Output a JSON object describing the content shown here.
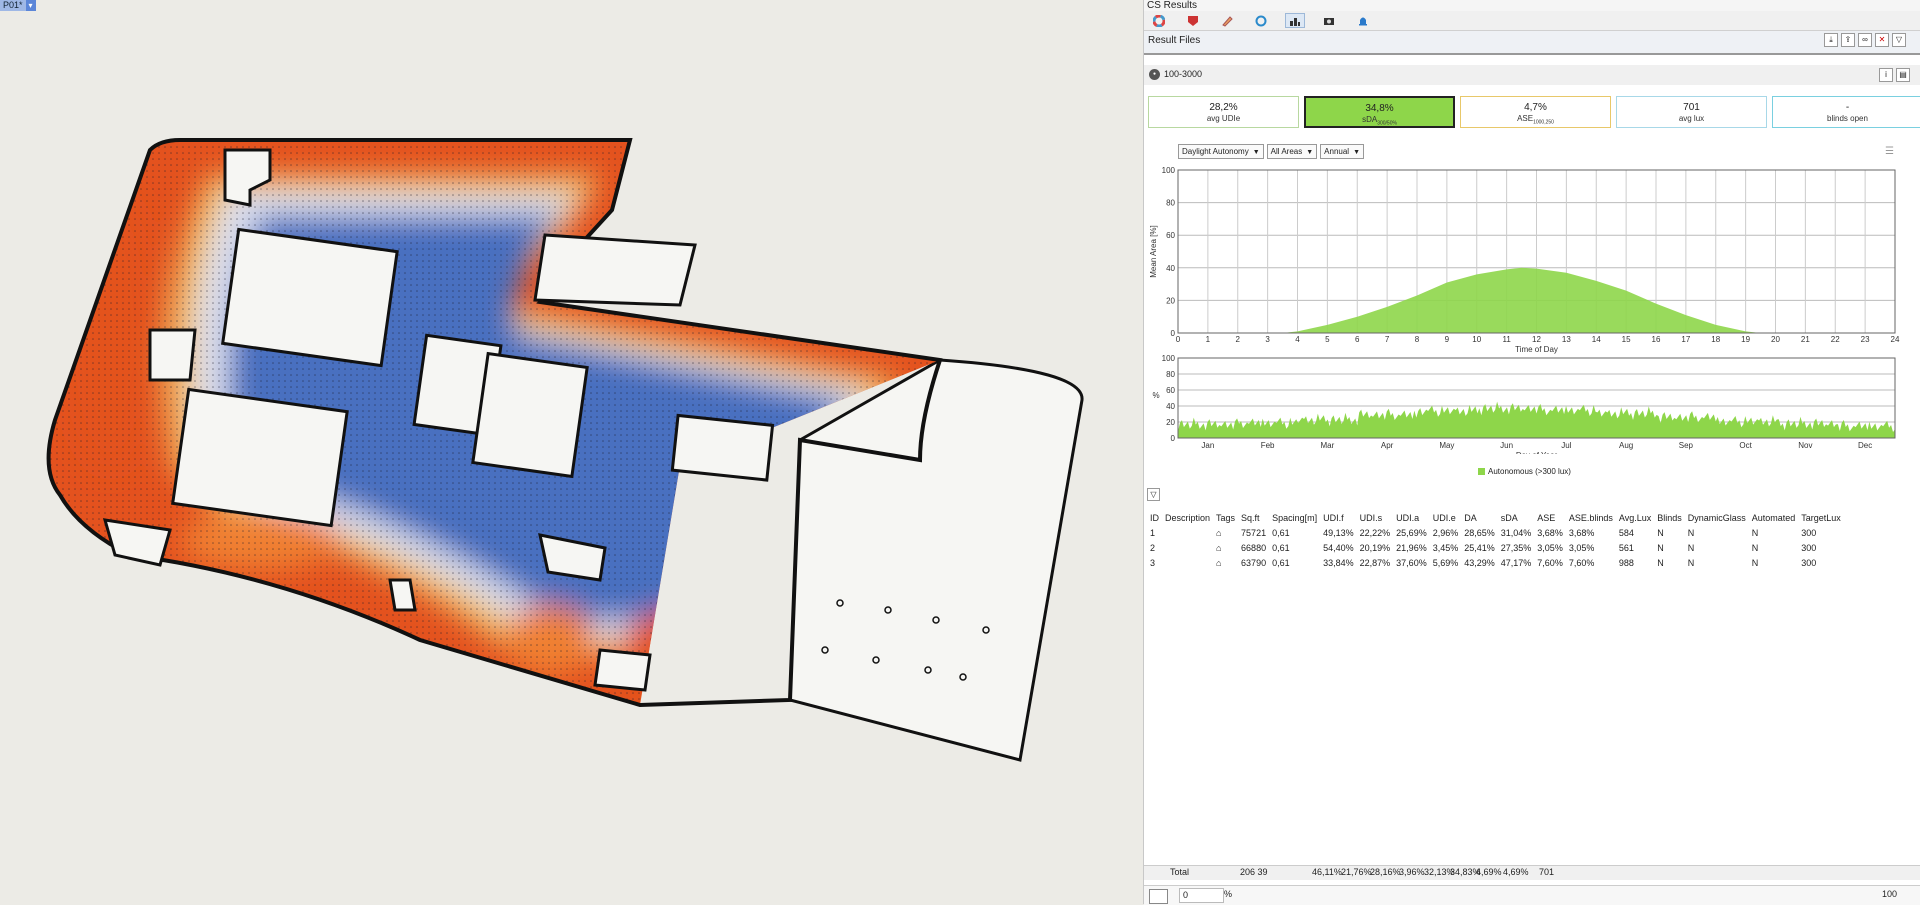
{
  "viewport": {
    "tag": "P01*"
  },
  "panel": {
    "title": "CS Results",
    "result_files": "Result Files",
    "metric": "100-3000",
    "cards": [
      {
        "value": "28,2%",
        "label": "avg UDIe",
        "sub": "",
        "border": "#b8d8a0",
        "bg": "#ffffff"
      },
      {
        "value": "34,8%",
        "label": "sDA",
        "sub": "300/50%",
        "border": "#222222",
        "bg": "#8ed64a"
      },
      {
        "value": "4,7%",
        "label": "ASE",
        "sub": "1000,250",
        "border": "#e8c86a",
        "bg": "#ffffff"
      },
      {
        "value": "701",
        "label": "avg lux",
        "sub": "",
        "border": "#a8d8e8",
        "bg": "#ffffff"
      },
      {
        "value": "-",
        "label": "blinds open",
        "sub": "",
        "border": "#7ad0e0",
        "bg": "#ffffff"
      }
    ],
    "dropdowns": [
      "Daylight Autonomy",
      "All Areas",
      "Annual"
    ],
    "legend": "Autonomous (>300 lux)",
    "table": {
      "headers": [
        "ID",
        "Description",
        "Tags",
        "Sq.ft",
        "Spacing[m]",
        "UDI.f",
        "UDI.s",
        "UDI.a",
        "UDI.e",
        "DA",
        "sDA",
        "ASE",
        "ASE.blinds",
        "Avg.Lux",
        "Blinds",
        "DynamicGlass",
        "Automated",
        "TargetLux"
      ],
      "rows": [
        [
          "1",
          "",
          "",
          "75721",
          "0,61",
          "49,13%",
          "22,22%",
          "25,69%",
          "2,96%",
          "28,65%",
          "31,04%",
          "3,68%",
          "3,68%",
          "584",
          "N",
          "N",
          "N",
          "300"
        ],
        [
          "2",
          "",
          "",
          "66880",
          "0,61",
          "54,40%",
          "20,19%",
          "21,96%",
          "3,45%",
          "25,41%",
          "27,35%",
          "3,05%",
          "3,05%",
          "561",
          "N",
          "N",
          "N",
          "300"
        ],
        [
          "3",
          "",
          "",
          "63790",
          "0,61",
          "33,84%",
          "22,87%",
          "37,60%",
          "5,69%",
          "43,29%",
          "47,17%",
          "7,60%",
          "7,60%",
          "988",
          "N",
          "N",
          "N",
          "300"
        ]
      ]
    },
    "totals": {
      "label": "Total",
      "sqft": "206 39",
      "udif": "46,11%",
      "udis": "21,76%",
      "udia": "28,16%",
      "udie": "3,96%",
      "da": "32,13%",
      "sda": "34,83%",
      "ase": "4,69%",
      "aseb": "4,69%",
      "lux": "701"
    },
    "bottom": {
      "value": "0",
      "unit": "%",
      "right": "100"
    }
  },
  "chart_data": [
    {
      "type": "area",
      "title": "",
      "xlabel": "Time of Day",
      "ylabel": "Mean Area [%]",
      "xlim": [
        0,
        24
      ],
      "ylim": [
        0,
        100
      ],
      "x": [
        0,
        1,
        2,
        3,
        3.5,
        4,
        5,
        6,
        7,
        8,
        9,
        10,
        11,
        11.5,
        12,
        13,
        14,
        15,
        16,
        17,
        18,
        19,
        19.5,
        20,
        21,
        22,
        23,
        24
      ],
      "values": [
        0,
        0,
        0,
        0,
        0,
        1,
        5,
        10,
        16,
        23,
        31,
        36,
        39,
        40,
        39.5,
        37,
        32,
        26,
        18,
        11,
        5,
        1,
        0,
        0,
        0,
        0,
        0,
        0
      ],
      "color": "#8ed64a"
    },
    {
      "type": "area",
      "title": "",
      "xlabel": "Day of Year",
      "ylabel": "%",
      "ylim": [
        0,
        100
      ],
      "months": [
        "Jan",
        "Feb",
        "Mar",
        "Apr",
        "May",
        "Jun",
        "Jul",
        "Aug",
        "Sep",
        "Oct",
        "Nov",
        "Dec"
      ],
      "monthly_values": [
        17,
        19,
        23,
        29,
        34,
        37,
        35,
        31,
        26,
        21,
        18,
        15
      ],
      "series": [
        {
          "name": "Autonomous (>300 lux)",
          "color": "#8ed64a"
        }
      ]
    }
  ]
}
